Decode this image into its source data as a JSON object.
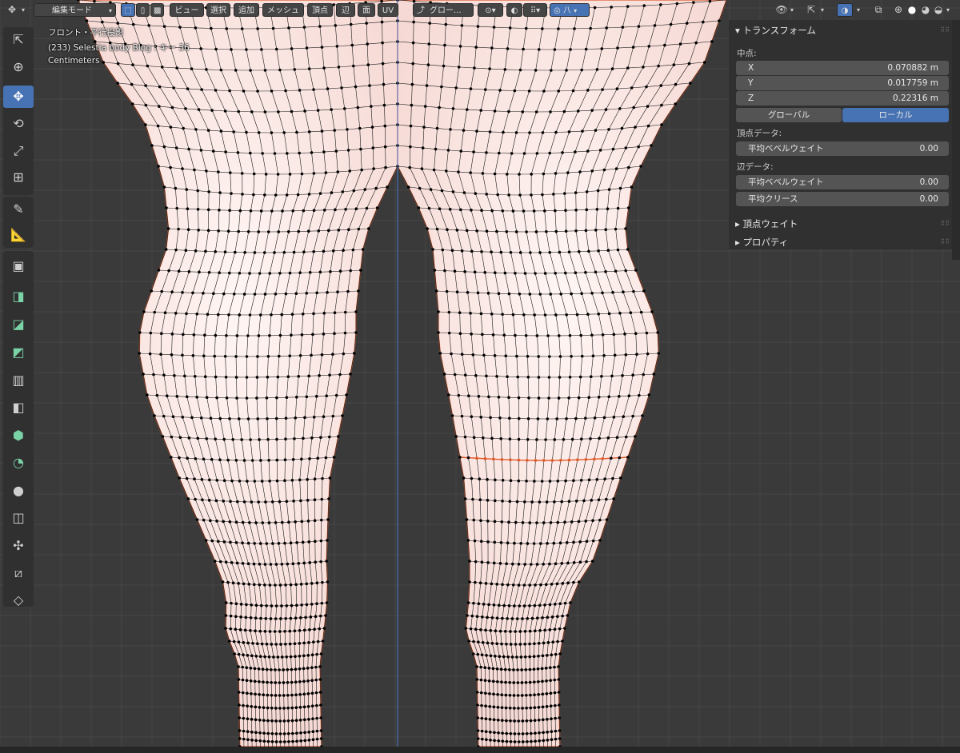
{
  "header": {
    "mode": "編集モード",
    "menus": [
      "ビュー",
      "選択",
      "追加",
      "メッシュ",
      "頂点",
      "辺",
      "面",
      "UV"
    ],
    "transform_orientation": "グロー...",
    "proportional_falloff": "八"
  },
  "overlay": {
    "view_name": "フロント・平行投影",
    "object_info": "(233) Selestia body Blog : キー 36",
    "units": "Centimeters"
  },
  "toolbar": {
    "tools": [
      "tweak-icon",
      "cursor-icon",
      "move-icon",
      "rotate-icon",
      "scale-icon",
      "transform-icon",
      "annotate-icon",
      "measure-icon",
      "add-cube-icon",
      "extrude-icon",
      "inset-icon",
      "bevel-icon",
      "loop-cut-icon",
      "knife-icon",
      "poly-build-icon",
      "spin-icon",
      "smooth-icon",
      "edge-slide-icon",
      "shrink-icon",
      "shear-icon",
      "rip-icon"
    ]
  },
  "panel": {
    "transform_title": "トランスフォーム",
    "median_label": "中点:",
    "x_label": "X",
    "x_value": "0.070882 m",
    "y_label": "Y",
    "y_value": "0.017759 m",
    "z_label": "Z",
    "z_value": "0.22316 m",
    "global_button": "グローバル",
    "local_button": "ローカル",
    "vertex_data_label": "頂点データ:",
    "vertex_bevel_weight": "平均ベベルウェイト",
    "vertex_bevel_value": "0.00",
    "edge_data_label": "辺データ:",
    "edge_bevel_weight": "平均ベベルウェイト",
    "edge_bevel_value": "0.00",
    "edge_crease": "平均クリース",
    "edge_crease_value": "0.00",
    "vertex_weights_title": "頂点ウェイト",
    "properties_title": "プロパティ"
  },
  "colors": {
    "viewport_bg": "#3a3a3a",
    "grid_line": "#474747",
    "mesh_fill": "#fbe8e4",
    "wire": "#1a1a1a",
    "selected_edge": "#e05a2a",
    "active_button": "#4772b3"
  }
}
